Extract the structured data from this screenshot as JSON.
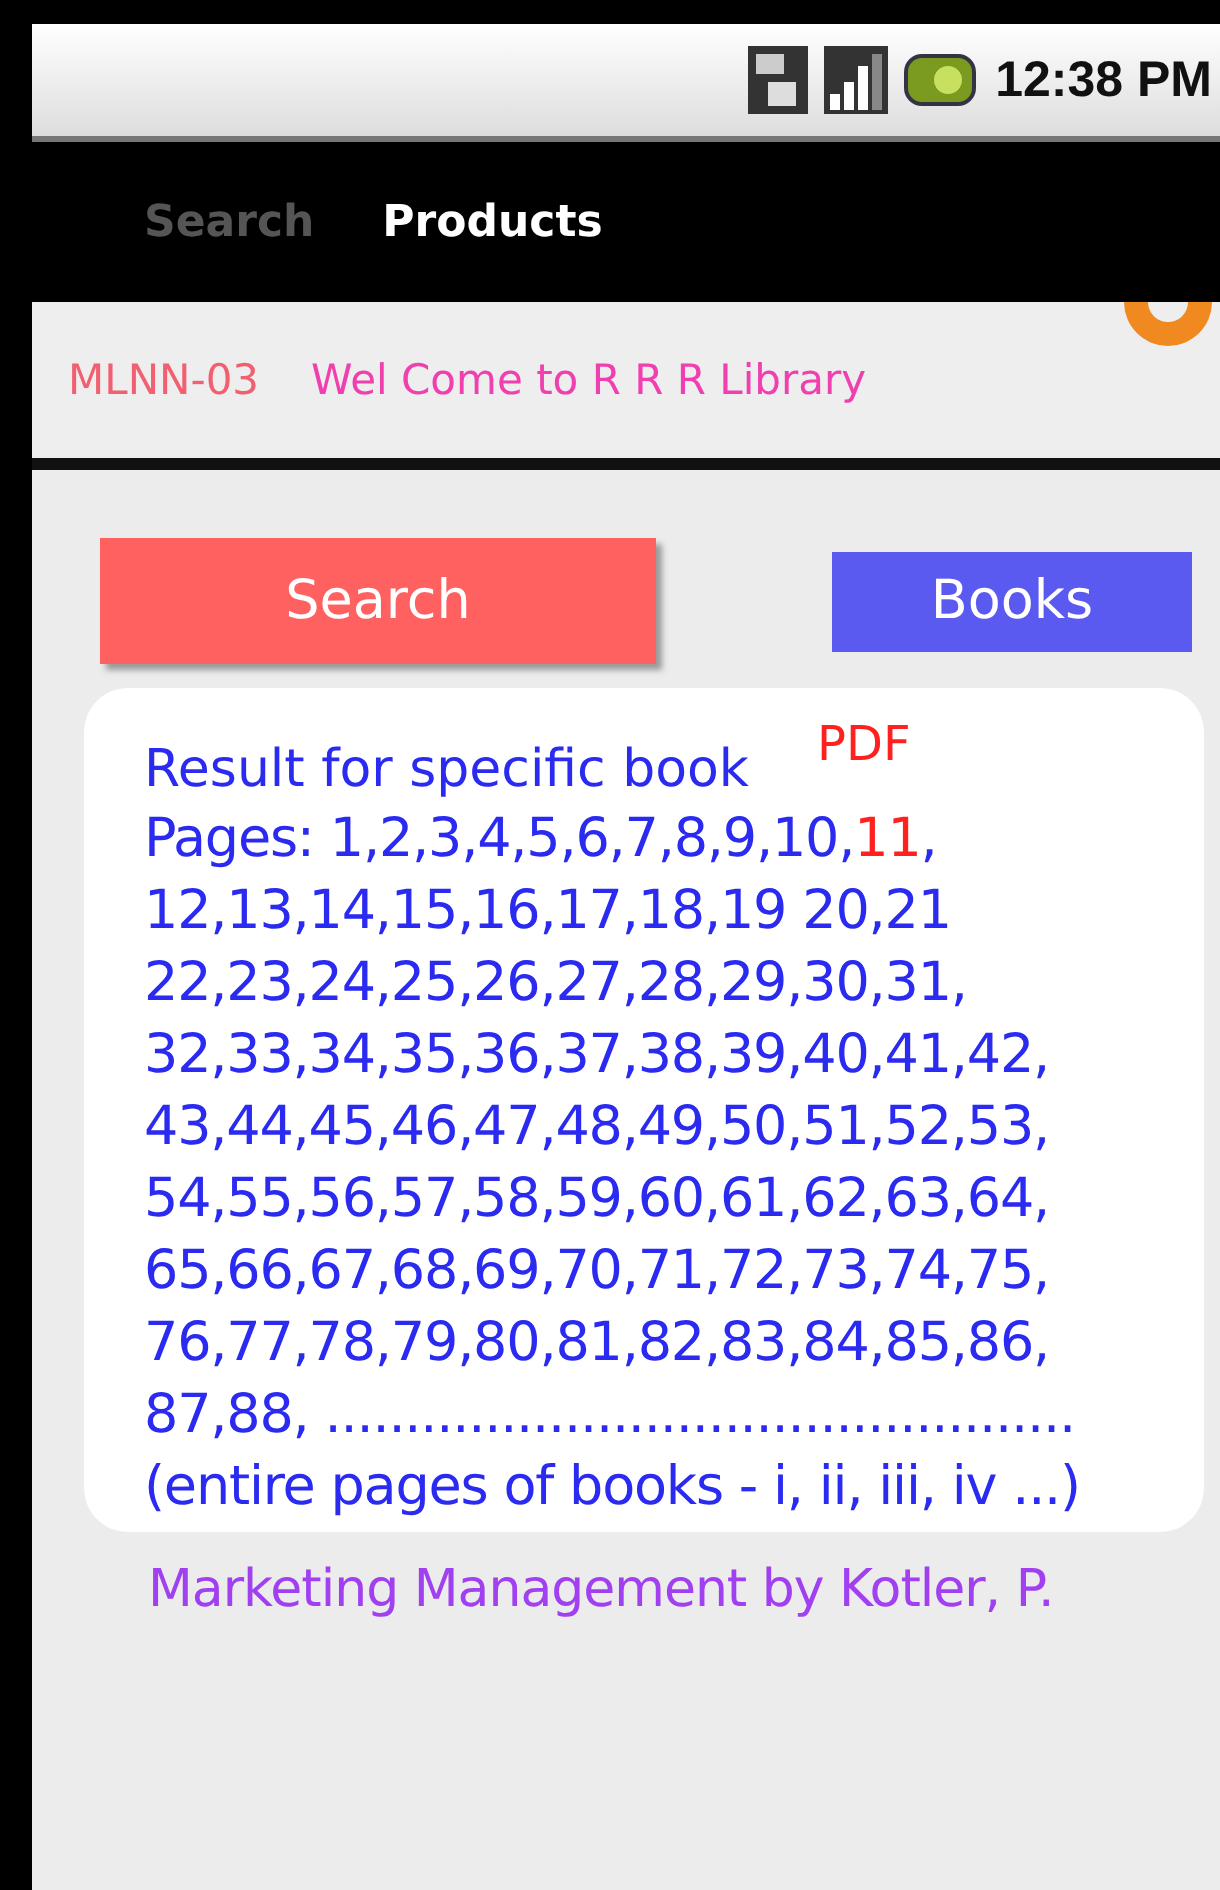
{
  "status_bar": {
    "time": "12:38 PM"
  },
  "tabs": [
    {
      "label": "Search",
      "selected": false
    },
    {
      "label": "Products",
      "selected": true
    }
  ],
  "header": {
    "code": "MLNN-03",
    "welcome": "Wel Come to R R R Library"
  },
  "buttons": [
    {
      "label": "Search",
      "kind": "primary"
    },
    {
      "label": "Books",
      "kind": "secondary"
    }
  ],
  "result": {
    "title": "Result for specific book",
    "badge": "PDF",
    "lines": [
      {
        "text": "Pages: 1,2,3,4,5,6,7,8,9,10,",
        "highlight": "11",
        "after": ","
      },
      {
        "text": "12,13,14,15,16,17,18,19 20,21"
      },
      {
        "text": "22,23,24,25,26,27,28,29,30,31,"
      },
      {
        "text": "32,33,34,35,36,37,38,39,40,41,42,"
      },
      {
        "text": "43,44,45,46,47,48,49,50,51,52,53,"
      },
      {
        "text": "54,55,56,57,58,59,60,61,62,63,64,"
      },
      {
        "text": "65,66,67,68,69,70,71,72,73,74,75,"
      },
      {
        "text": "76,77,78,79,80,81,82,83,84,85,86,"
      },
      {
        "text": "87,88, ..............................................."
      },
      {
        "text": "(entire pages of books - i, ii, iii, iv ...)"
      }
    ]
  },
  "book": "Marketing Management by Kotler, P."
}
